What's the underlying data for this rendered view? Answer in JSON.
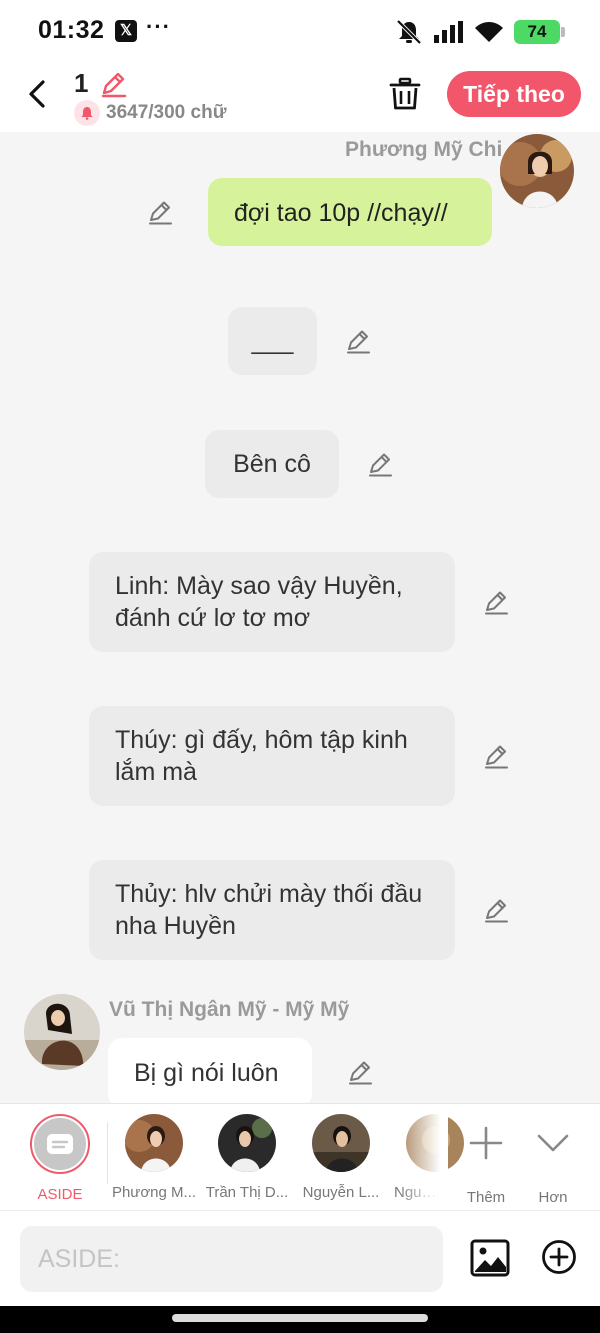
{
  "status_bar": {
    "time": "01:32",
    "app_icon": "x-icon",
    "x_glyph": "𝕏",
    "more": "···",
    "battery": "74"
  },
  "header": {
    "title": "1",
    "counter": "3647/300 chữ",
    "next_label": "Tiếp theo"
  },
  "messages": [
    {
      "sender": "Phương Mỹ Chi",
      "text": "đợi tao 10p //chạy//",
      "style": "right-green"
    },
    {
      "text": "___",
      "style": "center"
    },
    {
      "text": "Bên cô",
      "style": "center"
    },
    {
      "text": "Linh: Mày sao vậy Huyền, đánh cứ lơ tơ mơ",
      "style": "center"
    },
    {
      "text": "Thúy: gì đấy, hôm tập kinh lắm mà",
      "style": "center"
    },
    {
      "text": "Thủy: hlv chửi mày thối đầu nha Huyền",
      "style": "center"
    },
    {
      "sender": "Vũ Thị Ngân Mỹ - Mỹ Mỹ",
      "text": "Bị gì nói luôn",
      "style": "left-white"
    }
  ],
  "characters": [
    {
      "label": "ASIDE"
    },
    {
      "label": "Phương M..."
    },
    {
      "label": "Trần Thị D..."
    },
    {
      "label": "Nguyễn L..."
    },
    {
      "label": "Nguyễ..."
    }
  ],
  "actions": {
    "more_label": "Thêm",
    "collapse_label": "Hơn"
  },
  "input": {
    "placeholder": "ASIDE:"
  },
  "colors": {
    "accent": "#f2566b",
    "green_bubble": "#d6f29a",
    "gray_bubble": "#ebebeb"
  }
}
